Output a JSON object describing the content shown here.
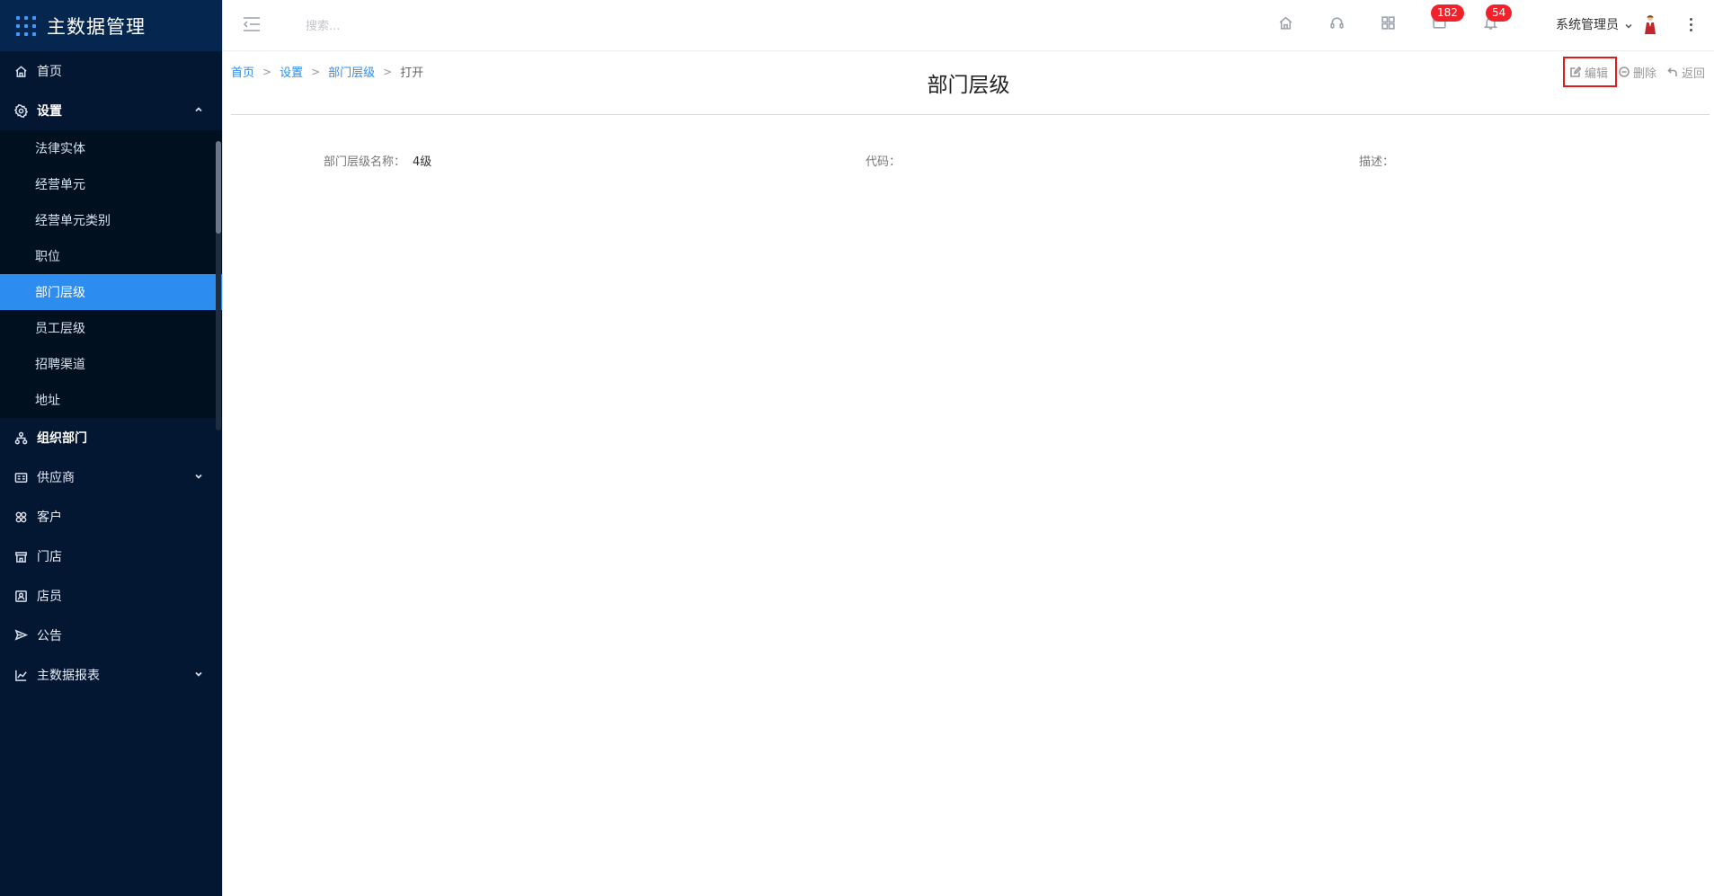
{
  "app": {
    "title": "主数据管理"
  },
  "sidebar": {
    "items": [
      {
        "label": "首页",
        "icon": "home-icon"
      },
      {
        "label": "设置",
        "icon": "gear-icon",
        "expanded": true,
        "children": [
          {
            "label": "法律实体"
          },
          {
            "label": "经营单元"
          },
          {
            "label": "经营单元类别"
          },
          {
            "label": "职位"
          },
          {
            "label": "部门层级",
            "active": true
          },
          {
            "label": "员工层级"
          },
          {
            "label": "招聘渠道"
          },
          {
            "label": "地址"
          }
        ]
      },
      {
        "label": "组织部门",
        "icon": "org-tree-icon"
      },
      {
        "label": "供应商",
        "icon": "vendor-card-icon"
      },
      {
        "label": "客户",
        "icon": "customer-icon"
      },
      {
        "label": "门店",
        "icon": "store-icon"
      },
      {
        "label": "店员",
        "icon": "staff-icon"
      },
      {
        "label": "公告",
        "icon": "announcement-icon"
      },
      {
        "label": "主数据报表",
        "icon": "line-chart-icon"
      }
    ]
  },
  "header": {
    "search_placeholder": "搜索...",
    "badges": {
      "messages": "182",
      "notifications": "54"
    },
    "user_name": "系统管理员"
  },
  "breadcrumb": {
    "items": [
      "首页",
      "设置",
      "部门层级"
    ],
    "current": "打开",
    "separator": ">"
  },
  "actions": {
    "edit": "编辑",
    "delete": "删除",
    "back": "返回"
  },
  "page": {
    "title": "部门层级",
    "fields": [
      {
        "label": "部门层级名称：",
        "value": "4级"
      },
      {
        "label": "代码：",
        "value": ""
      },
      {
        "label": "描述：",
        "value": ""
      }
    ]
  },
  "colors": {
    "sidebar_bg": "#031733",
    "brand_bg": "#04264f",
    "active_item": "#2d8cf0",
    "badge": "#f0232d",
    "highlight_border": "#e11b1b"
  }
}
